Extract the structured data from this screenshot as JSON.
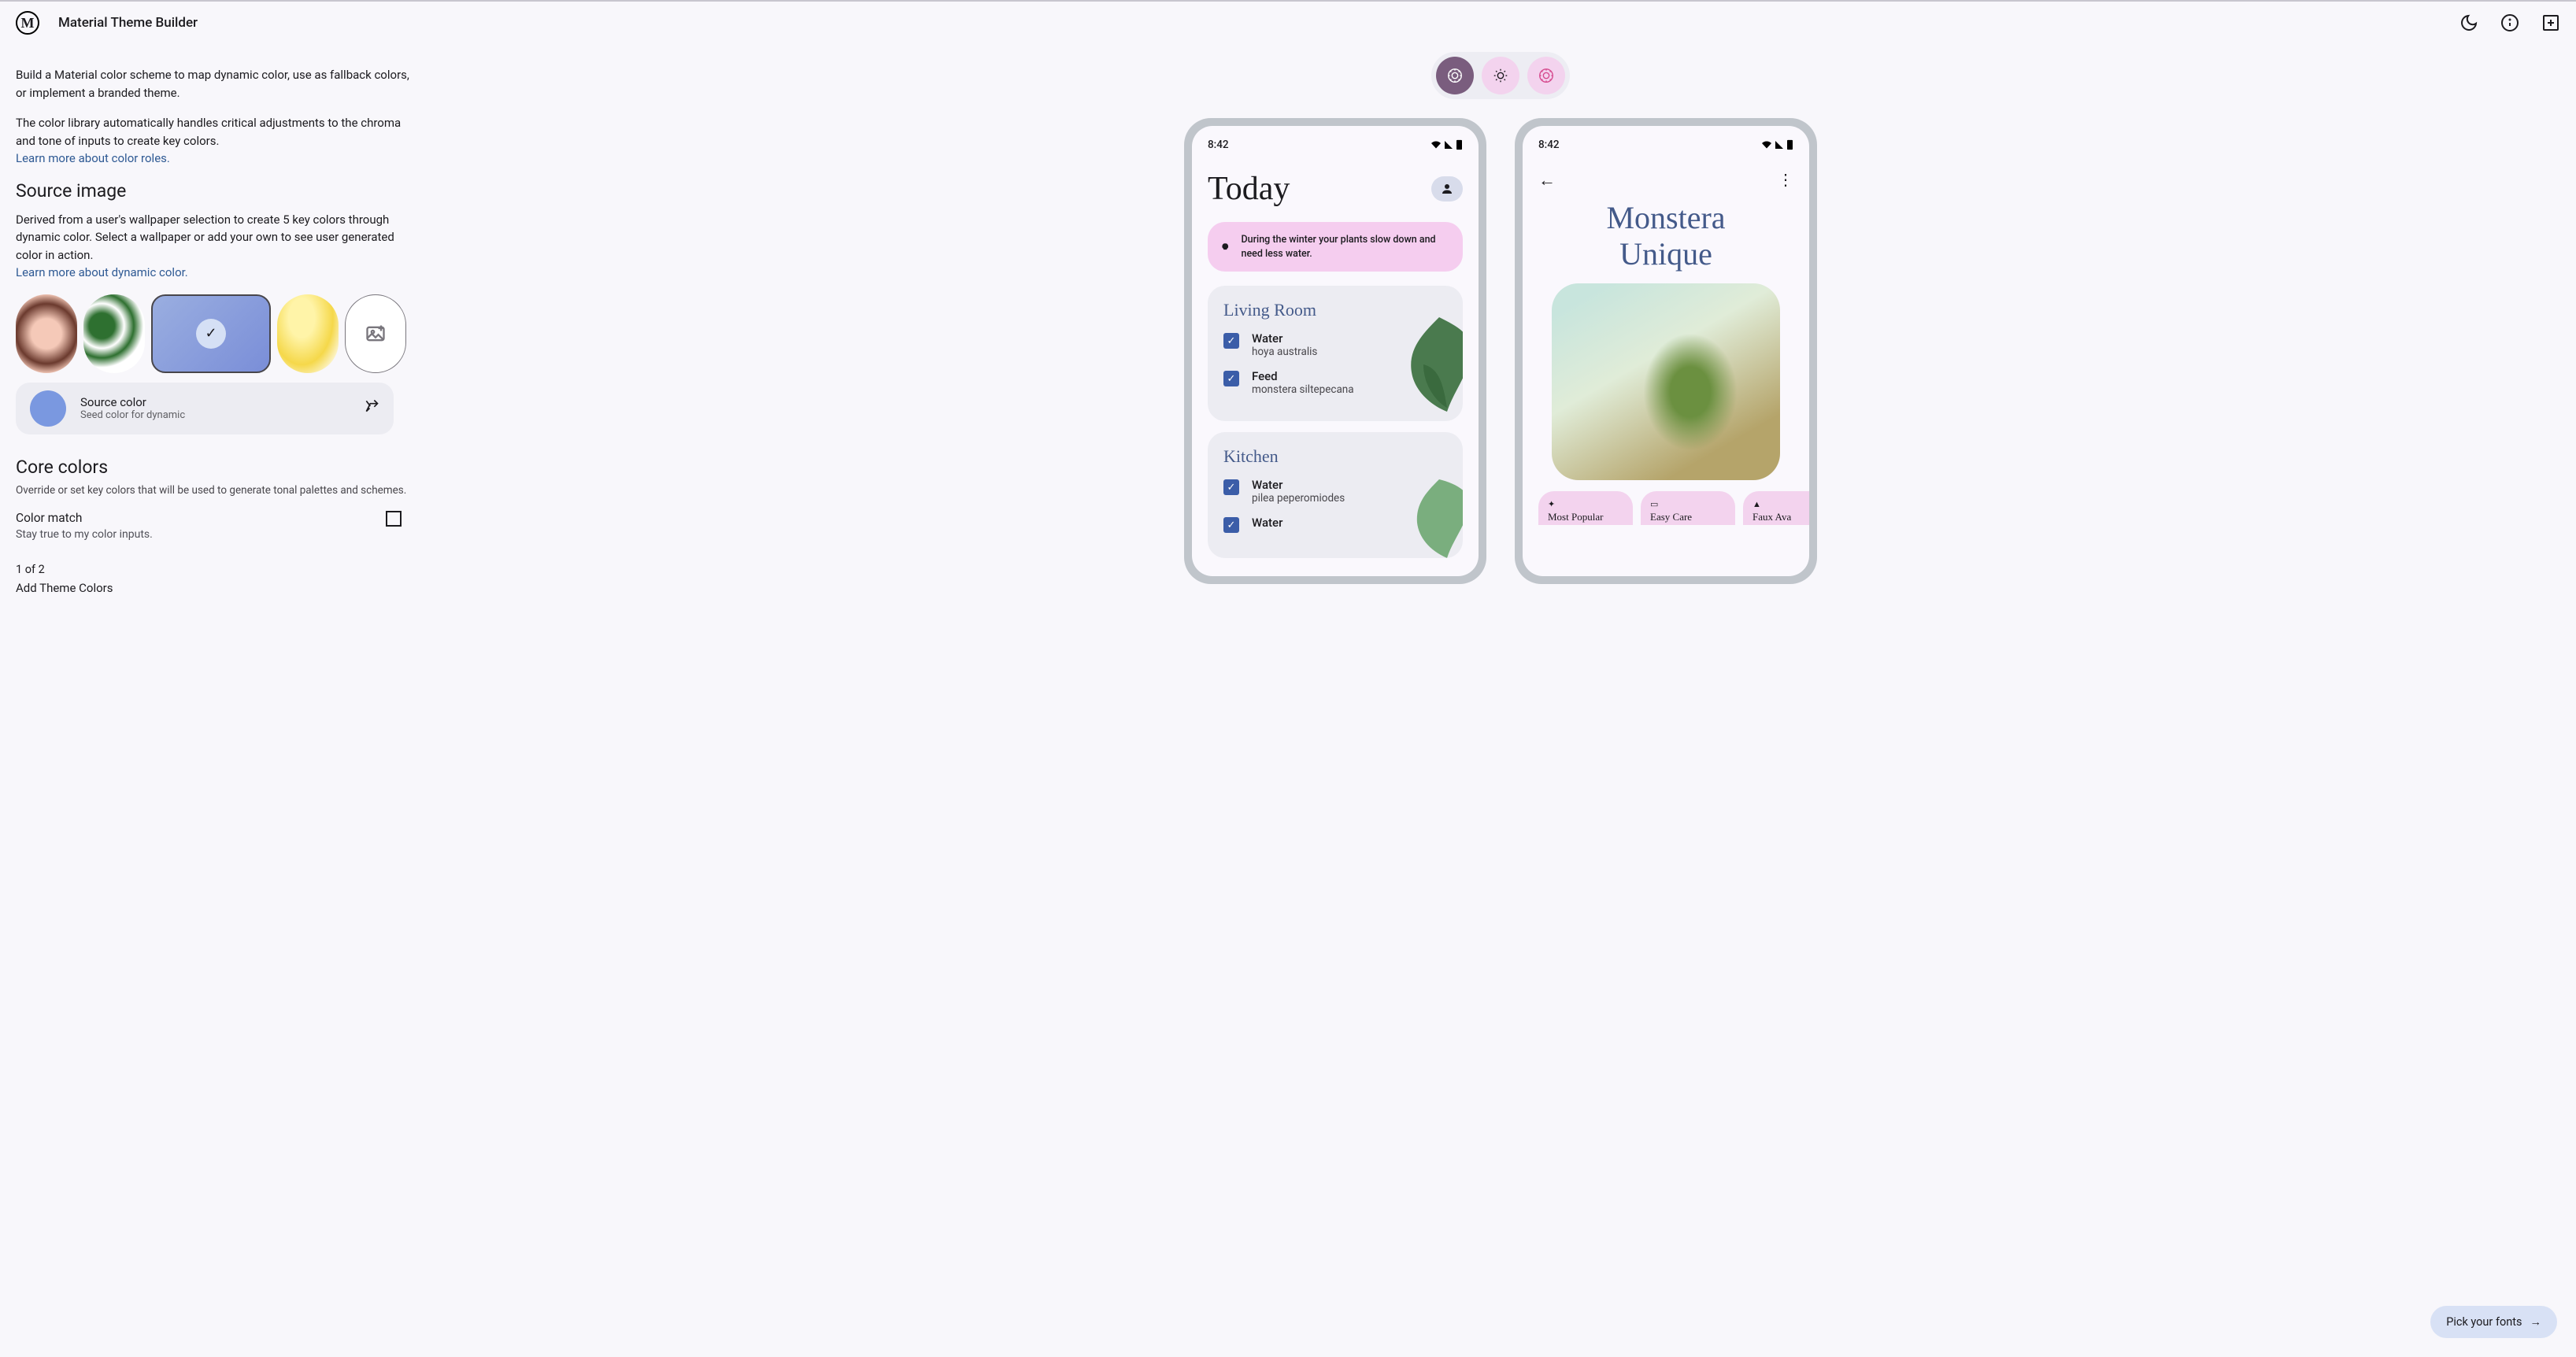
{
  "header": {
    "logo_letter": "M",
    "title": "Material Theme Builder"
  },
  "left": {
    "intro1": "Build a Material color scheme to map dynamic color, use as fallback colors, or implement a branded theme.",
    "intro2": "The color library automatically handles critical adjustments to the chroma and tone of inputs to create key colors.",
    "learn_color_roles": "Learn more about color roles.",
    "source_image_heading": "Source image",
    "source_desc": "Derived from a user's wallpaper selection to create 5 key colors through dynamic color. Select a wallpaper or add your own to see user generated color in action.",
    "learn_dynamic": "Learn more about dynamic color.",
    "source_color_label": "Source color",
    "source_color_sub": "Seed color for dynamic",
    "source_color_hex": "#7a98e0",
    "core_colors_heading": "Core colors",
    "core_colors_sub": "Override or set key colors that will be used to generate tonal palettes and schemes.",
    "color_match_label": "Color match",
    "color_match_sub": "Stay true to my color inputs.",
    "pager": "1 of 2",
    "pager_title": "Add Theme Colors"
  },
  "phone1": {
    "time": "8:42",
    "title": "Today",
    "tip": "During the winter your plants slow down and need less water.",
    "room1_title": "Living Room",
    "room1_tasks": [
      {
        "label": "Water",
        "sub": "hoya australis"
      },
      {
        "label": "Feed",
        "sub": "monstera siltepecana"
      }
    ],
    "room2_title": "Kitchen",
    "room2_tasks": [
      {
        "label": "Water",
        "sub": "pilea peperomiodes"
      },
      {
        "label": "Water",
        "sub": ""
      }
    ]
  },
  "phone2": {
    "time": "8:42",
    "title_line1": "Monstera",
    "title_line2": "Unique",
    "chips": [
      {
        "label": "Most Popular"
      },
      {
        "label": "Easy Care"
      },
      {
        "label": "Faux Ava"
      }
    ]
  },
  "fab": {
    "label": "Pick your fonts"
  }
}
